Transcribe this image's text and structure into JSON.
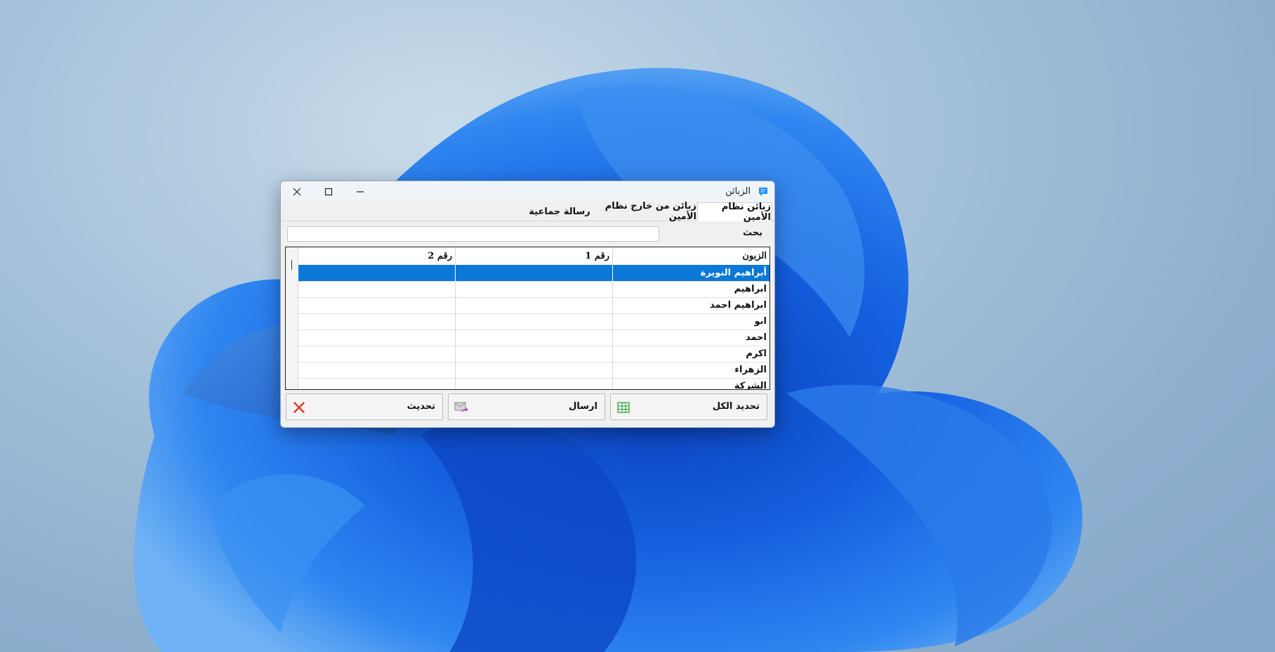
{
  "window": {
    "title": "الزبائن"
  },
  "tabs": [
    {
      "label": "زبائن نظام الأمين"
    },
    {
      "label": "زبائن من خارج نظام الأمين"
    },
    {
      "label": "رسالة جماعية"
    }
  ],
  "search": {
    "label": "بحث",
    "value": ""
  },
  "table": {
    "columns": [
      "الزبون",
      "رقم 1",
      "رقم 2"
    ],
    "rows": [
      {
        "name": "أبراهيم النويرة",
        "num1": "",
        "num2": ""
      },
      {
        "name": "ابراهيم",
        "num1": "",
        "num2": ""
      },
      {
        "name": "ابراهيم احمد",
        "num1": "",
        "num2": ""
      },
      {
        "name": "ابو",
        "num1": "",
        "num2": ""
      },
      {
        "name": "احمد",
        "num1": "",
        "num2": ""
      },
      {
        "name": "اكرم",
        "num1": "",
        "num2": ""
      },
      {
        "name": "الزهراء",
        "num1": "",
        "num2": ""
      },
      {
        "name": "الشركة",
        "num1": "",
        "num2": ""
      }
    ]
  },
  "buttons": {
    "select_all": "تحديد الكل",
    "send": "ارسال",
    "refresh": "تحديث"
  },
  "colors": {
    "selection": "#0b78d7",
    "accent": "#1f8fff"
  }
}
